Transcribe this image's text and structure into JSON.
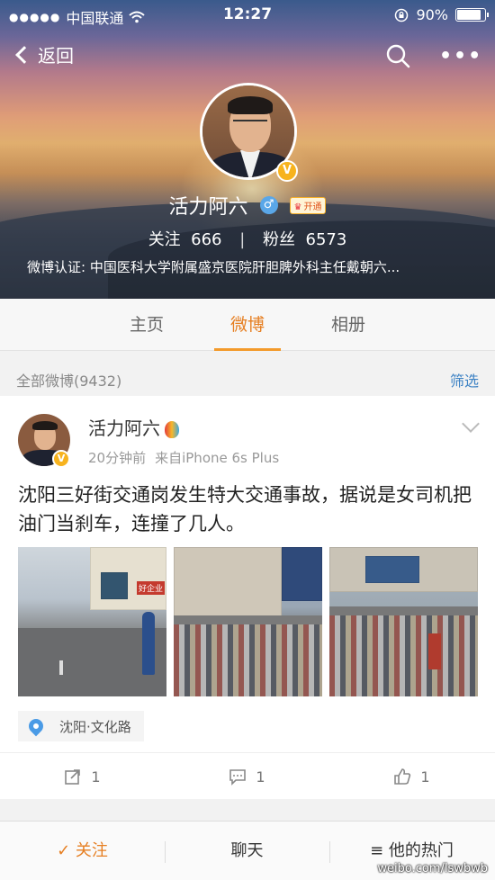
{
  "status_bar": {
    "carrier": "中国联通",
    "time": "12:27",
    "battery": "90%"
  },
  "nav": {
    "back_label": "返回"
  },
  "profile": {
    "name": "活力阿六",
    "vip_label": "开通",
    "following_label": "关注",
    "following_count": "666",
    "followers_label": "粉丝",
    "followers_count": "6573",
    "verification": "微博认证: 中国医科大学附属盛京医院肝胆脾外科主任戴朝六..."
  },
  "tabs": [
    "主页",
    "微博",
    "相册"
  ],
  "active_tab": 1,
  "feed_header": {
    "all_label": "全部微博(9432)",
    "filter_label": "筛选"
  },
  "post": {
    "author": "活力阿六",
    "time": "20分钟前",
    "source": "来自iPhone 6s Plus",
    "text": "沈阳三好街交通岗发生特大交通事故，据说是女司机把油门当刹车，连撞了几人。",
    "location": "沈阳·文化路",
    "reposts": "1",
    "comments": "1",
    "likes": "1"
  },
  "bottom_bar": {
    "follow": "✓ 关注",
    "chat": "聊天",
    "hot": "≡ 他的热门"
  },
  "watermark": "weibo.com/lswbwb",
  "colors": {
    "accent": "#e67f22",
    "link": "#3d82c4",
    "vip": "#f7b31e"
  }
}
